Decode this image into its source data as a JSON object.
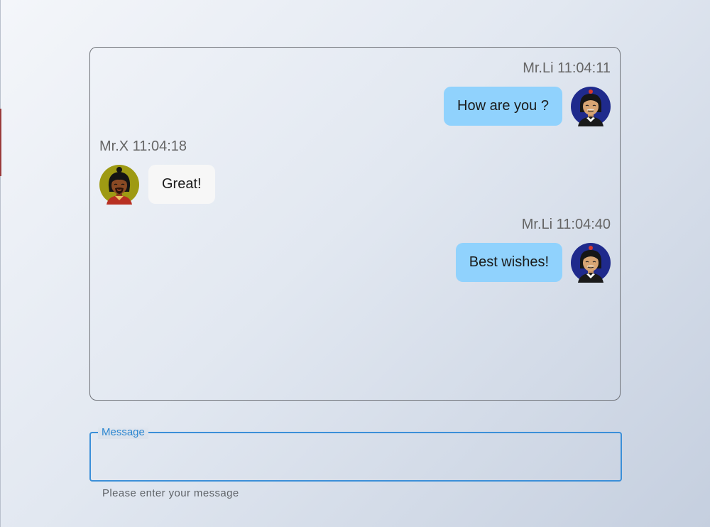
{
  "colors": {
    "outgoing_bubble": "#90d2fd",
    "incoming_bubble": "#f7f7f7",
    "focus_accent": "#3b8fd8",
    "meta_text": "#666666"
  },
  "chat": {
    "messages": [
      {
        "sender": "Mr.Li",
        "time": "11:04:11",
        "header": "Mr.Li 11:04:11",
        "text": "How are you ?",
        "side": "right",
        "avatar": "man-with-topknot-avatar"
      },
      {
        "sender": "Mr.X",
        "time": "11:04:18",
        "header": "Mr.X 11:04:18",
        "text": "Great!",
        "side": "left",
        "avatar": "bearded-man-avatar"
      },
      {
        "sender": "Mr.Li",
        "time": "11:04:40",
        "header": "Mr.Li 11:04:40",
        "text": "Best wishes!",
        "side": "right",
        "avatar": "man-with-topknot-avatar"
      }
    ]
  },
  "composer": {
    "label": "Message",
    "value": "",
    "helper_text": "Please enter your message"
  }
}
